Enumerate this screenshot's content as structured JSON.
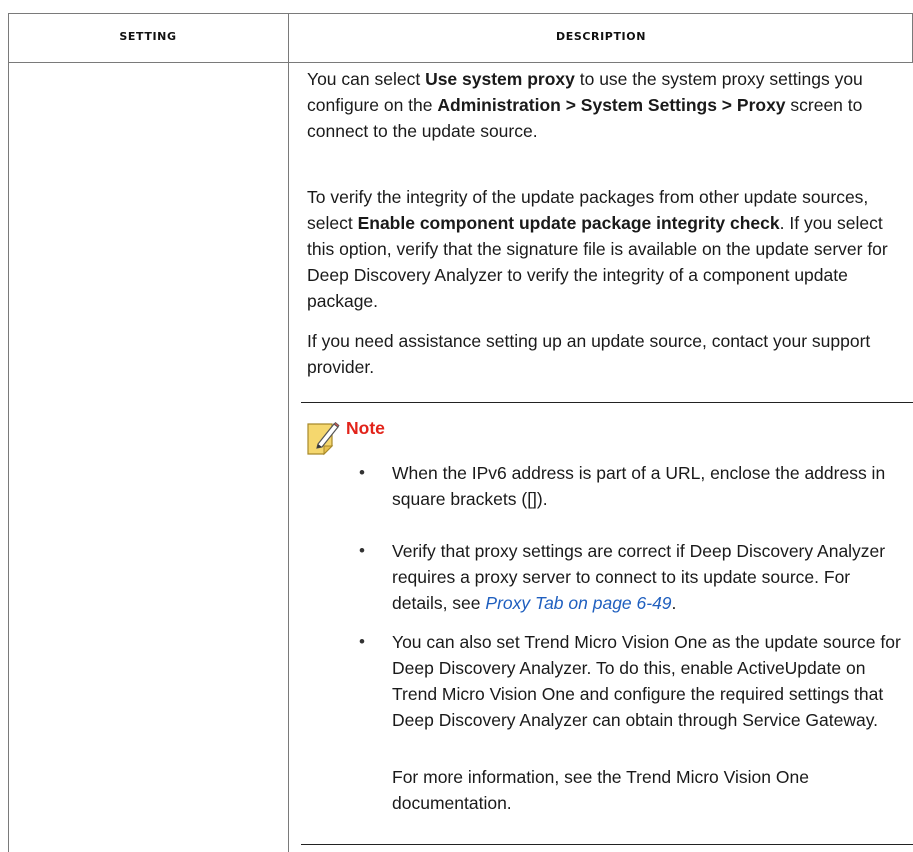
{
  "table": {
    "headers": {
      "setting": "Setting",
      "description": "Description"
    }
  },
  "description": {
    "p1": {
      "t1": "You can select ",
      "b1": "Use system proxy",
      "t2": " to use the system proxy settings you configure on the ",
      "b2": "Administration > System Settings > Proxy",
      "t3": " screen to connect to the update source."
    },
    "p2": {
      "t1": "To verify the integrity of the update packages from other update sources, select ",
      "b1": "Enable component update package integrity check",
      "t2": ". If you select this option, verify that the signature file is available on the update server for Deep Discovery Analyzer to verify the integrity of a component update package."
    },
    "p3": "If you need assistance setting up an update source, contact your support provider."
  },
  "note": {
    "title": "Note",
    "icon": "note-pencil-icon",
    "bullet_char": "•",
    "items": [
      {
        "text": "When the IPv6 address is part of a URL, enclose the address in square brackets ([])."
      },
      {
        "text_before_link": "Verify that proxy settings are correct if Deep Discovery Analyzer requires a proxy server to connect to its update source. For details, see ",
        "link": "Proxy Tab on page 6-49",
        "text_after_link": "."
      },
      {
        "text": "You can also set Trend Micro Vision One as the update source for Deep Discovery Analyzer. To do this, enable ActiveUpdate on Trend Micro Vision One and configure the required settings that Deep Discovery Analyzer can obtain through Service Gateway.",
        "followup": "For more information, see the Trend Micro Vision One documentation."
      }
    ]
  },
  "colors": {
    "note_title": "#e2231a",
    "link": "#1f5fbf",
    "icon_fill": "#f5d76e"
  }
}
